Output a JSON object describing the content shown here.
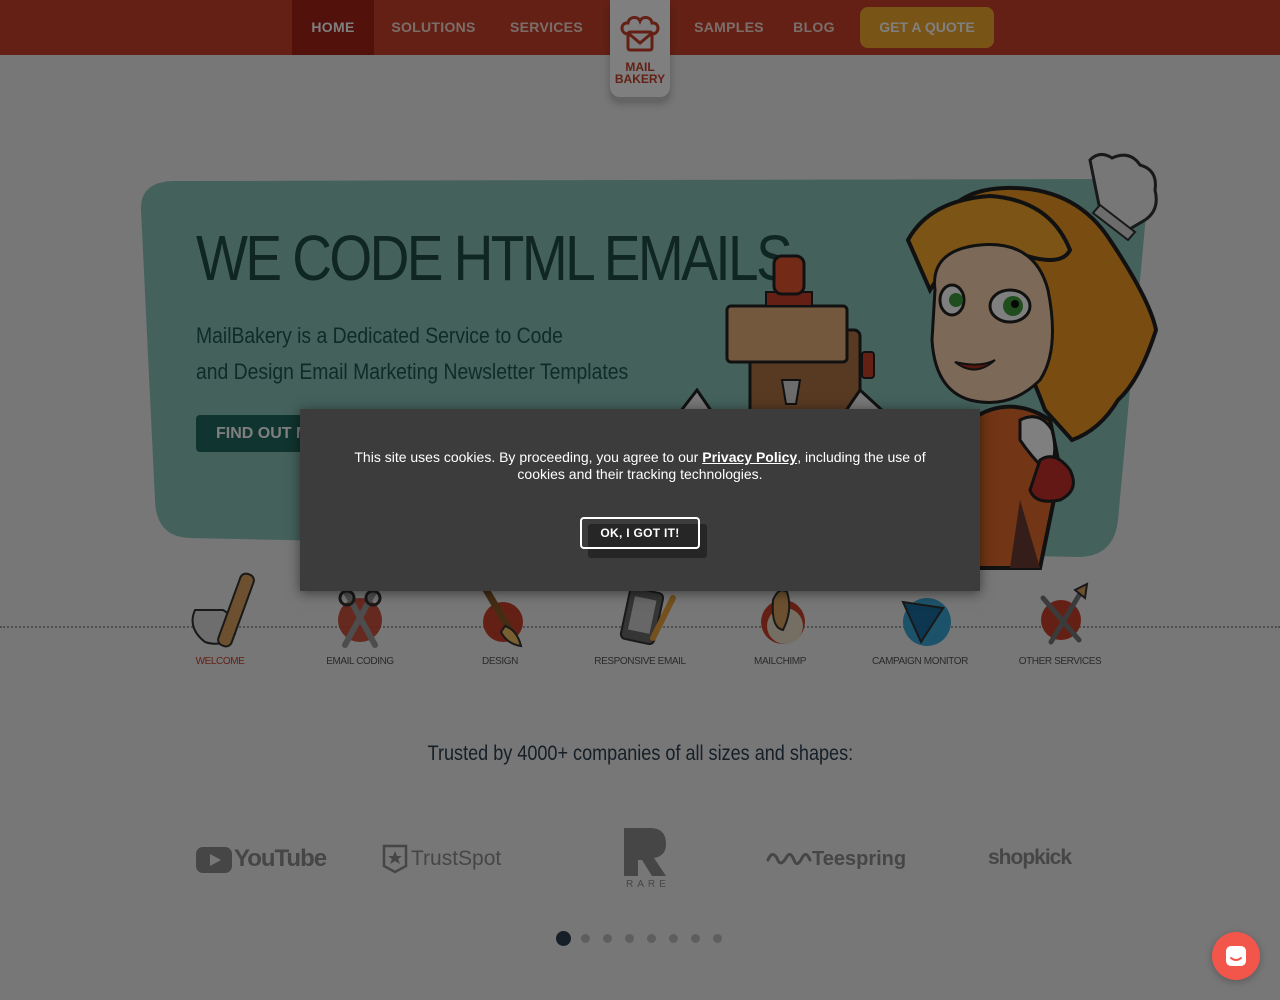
{
  "nav": {
    "items": [
      {
        "label": "HOME",
        "active": true
      },
      {
        "label": "SOLUTIONS",
        "active": false
      },
      {
        "label": "SERVICES",
        "active": false
      },
      {
        "label": "SAMPLES",
        "active": false
      },
      {
        "label": "BLOG",
        "active": false
      }
    ],
    "cta": "GET A QUOTE",
    "logo_line1": "MAIL",
    "logo_line2": "BAKERY"
  },
  "hero": {
    "title": "WE CODE HTML EMAILS",
    "subtitle_line1": "MailBakery is a Dedicated Service to Code",
    "subtitle_line2": "and Design Email Marketing Newsletter Templates",
    "button": "FIND OUT MORE"
  },
  "services": [
    {
      "label": "WELCOME",
      "icon": "rolling-pin-icon",
      "active": true
    },
    {
      "label": "EMAIL CODING",
      "icon": "scissors-icon",
      "active": false
    },
    {
      "label": "DESIGN",
      "icon": "brush-icon",
      "active": false
    },
    {
      "label": "RESPONSIVE EMAIL",
      "icon": "phone-pencil-icon",
      "active": false
    },
    {
      "label": "MAILCHIMP",
      "icon": "mailchimp-icon",
      "active": false
    },
    {
      "label": "CAMPAIGN MONITOR",
      "icon": "campaign-monitor-icon",
      "active": false
    },
    {
      "label": "OTHER SERVICES",
      "icon": "tools-icon",
      "active": false
    }
  ],
  "trusted": {
    "heading": "Trusted by 4000+ companies of all sizes and shapes:",
    "brands": [
      "YouTube",
      "TrustSpot",
      "RARE",
      "Teespring",
      "shopkick"
    ],
    "slide_count": 8,
    "active_slide": 1
  },
  "cookie": {
    "text_before": "This site uses cookies. By proceeding, you agree to our ",
    "link": "Privacy Policy",
    "text_after": ", including the use of cookies and their tracking technologies.",
    "button": "OK, I GOT IT!"
  },
  "colors": {
    "nav_bg": "#c8412b",
    "nav_active": "#a52316",
    "cta": "#f3a82f",
    "hero_panel": "#88c3b8",
    "hero_text": "#1f4c47"
  }
}
